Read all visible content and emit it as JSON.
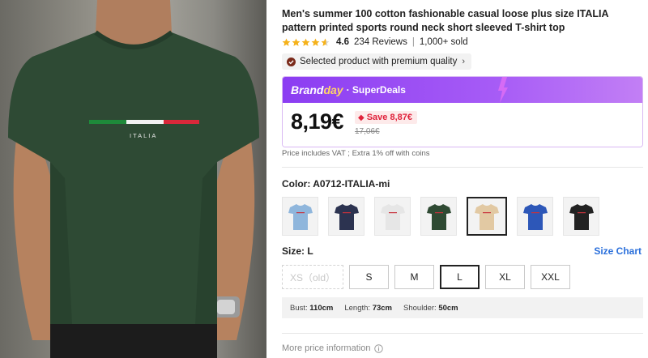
{
  "product": {
    "title": "Men's summer 100 cotton fashionable casual loose plus size ITALIA pattern printed sports round neck short sleeved T-shirt top",
    "rating": "4.6",
    "reviews": "234 Reviews",
    "separator": "|",
    "sold": "1,000+ sold",
    "quality_badge": "Selected product with premium quality",
    "shirt_print": "ITALIA"
  },
  "deal": {
    "brand": "Brand",
    "brand_day": "day",
    "super": "· SuperDeals",
    "price": "8,19€",
    "save": "Save 8,87€",
    "original_price": "17,06€",
    "vat_note": "Price includes VAT ; Extra 1% off with coins"
  },
  "color": {
    "label": "Color: A0712-ITALIA-mi",
    "options": [
      {
        "name": "light-blue",
        "hex": "#8fb6dc"
      },
      {
        "name": "navy",
        "hex": "#2c3350"
      },
      {
        "name": "white",
        "hex": "#e6e6e6"
      },
      {
        "name": "dark-green",
        "hex": "#2f4a33"
      },
      {
        "name": "beige",
        "hex": "#e2c9a3",
        "selected": true
      },
      {
        "name": "royal-blue",
        "hex": "#2d57b8"
      },
      {
        "name": "black",
        "hex": "#222222"
      }
    ]
  },
  "size": {
    "label": "Size: L",
    "chart_link": "Size Chart",
    "options": [
      {
        "label": "XS（old）",
        "state": "disabled"
      },
      {
        "label": "S",
        "state": "normal"
      },
      {
        "label": "M",
        "state": "normal"
      },
      {
        "label": "L",
        "state": "selected"
      },
      {
        "label": "XL",
        "state": "normal"
      },
      {
        "label": "XXL",
        "state": "normal"
      }
    ],
    "measurements": {
      "bust_label": "Bust:",
      "bust_value": "110cm",
      "length_label": "Length:",
      "length_value": "73cm",
      "shoulder_label": "Shoulder:",
      "shoulder_value": "50cm"
    }
  },
  "footer": {
    "more_price": "More price information"
  },
  "colors": {
    "accent_purple": "#8b3df2",
    "save_red": "#e0223b",
    "link_blue": "#2a6fdb",
    "star_yellow": "#f5b21b"
  }
}
